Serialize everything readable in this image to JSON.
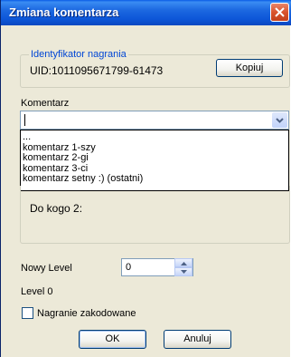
{
  "window": {
    "title": "Zmiana komentarza"
  },
  "identifier": {
    "group_label": "Identyfikator nagrania",
    "uid_text": "UID:1011095671799-61473",
    "copy_button": "Kopiuj"
  },
  "comment": {
    "label": "Komentarz",
    "input_value": "",
    "dropdown_items": [
      "...",
      "komentarz 1-szy",
      "komentarz 2-gi",
      "komentarz 3-ci",
      "komentarz setny :) (ostatni)"
    ]
  },
  "recipient": {
    "label": "Do kogo 2:"
  },
  "level": {
    "new_level_label": "Nowy Level",
    "new_level_value": "0",
    "current_level_text": "Level 0"
  },
  "encoded": {
    "label": "Nagranie zakodowane",
    "checked": false
  },
  "buttons": {
    "ok": "OK",
    "cancel": "Anuluj"
  },
  "colors": {
    "titlebar": "#0d56d8",
    "dialog_background": "#ece9d8",
    "group_legend": "#0046d5",
    "close_button": "#d9542d"
  },
  "icons": {
    "close": "close-icon",
    "dropdown": "chevron-down-icon",
    "spin_up": "spin-up-icon",
    "spin_down": "spin-down-icon"
  }
}
